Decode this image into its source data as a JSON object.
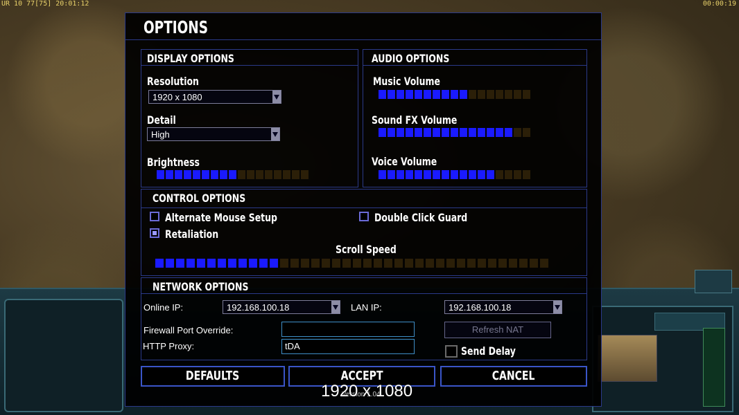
{
  "hud_top": {
    "left": "UR 10 77[75] 20:01:12",
    "right": "00:00:19"
  },
  "dialog": {
    "title": "OPTIONS",
    "display": {
      "title": "DISPLAY OPTIONS",
      "resolution_label": "Resolution",
      "resolution_value": "1920 x 1080",
      "detail_label": "Detail",
      "detail_value": "High",
      "brightness_label": "Brightness",
      "brightness_level": 9,
      "brightness_max": 17
    },
    "audio": {
      "title": "AUDIO OPTIONS",
      "music_label": "Music Volume",
      "music_level": 10,
      "music_max": 17,
      "sfx_label": "Sound FX Volume",
      "sfx_level": 15,
      "sfx_max": 17,
      "voice_label": "Voice Volume",
      "voice_level": 13,
      "voice_max": 17
    },
    "control": {
      "title": "CONTROL OPTIONS",
      "alt_mouse_label": "Alternate Mouse Setup",
      "alt_mouse_checked": false,
      "double_click_label": "Double Click Guard",
      "double_click_checked": false,
      "retaliation_label": "Retaliation",
      "retaliation_checked": true,
      "scroll_label": "Scroll Speed",
      "scroll_level": 12,
      "scroll_max": 38
    },
    "network": {
      "title": "NETWORK OPTIONS",
      "online_ip_label": "Online IP:",
      "online_ip_value": "192.168.100.18",
      "lan_ip_label": "LAN IP:",
      "lan_ip_value": "192.168.100.18",
      "firewall_label": "Firewall Port Override:",
      "firewall_value": "",
      "proxy_label": "HTTP Proxy:",
      "proxy_value": "tDA",
      "refresh_nat_label": "Refresh NAT",
      "send_delay_label": "Send Delay",
      "send_delay_checked": false
    },
    "buttons": {
      "defaults": "DEFAULTS",
      "accept": "ACCEPT",
      "cancel": "CANCEL"
    },
    "version": "Version 1.04"
  },
  "overlay_resolution": "1920 x 1080",
  "colors": {
    "slider_on": "#1a1aff",
    "slider_off": "#2b1f08",
    "panel_border": "#2b3a8a"
  }
}
